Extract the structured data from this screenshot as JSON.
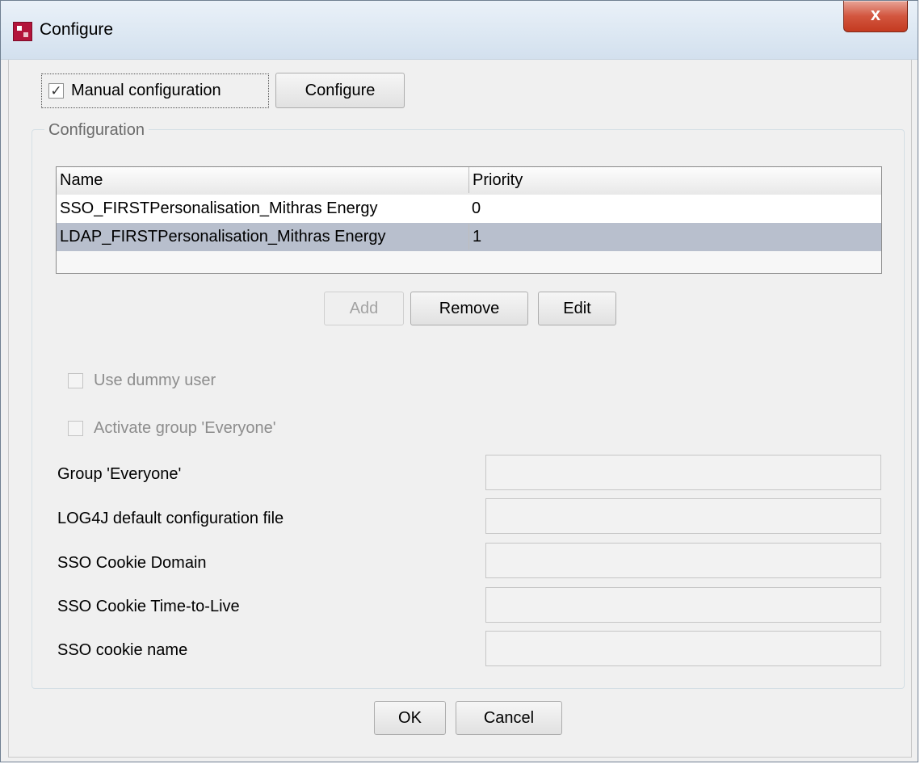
{
  "window": {
    "title": "Configure",
    "close_label": "x"
  },
  "top": {
    "manual_config_label": "Manual configuration",
    "manual_config_checked": true,
    "configure_button": "Configure"
  },
  "group": {
    "legend": "Configuration",
    "table": {
      "columns": [
        "Name",
        "Priority"
      ],
      "rows": [
        {
          "name": "SSO_FIRSTPersonalisation_Mithras Energy",
          "priority": "0",
          "selected": false
        },
        {
          "name": "LDAP_FIRSTPersonalisation_Mithras Energy",
          "priority": "1",
          "selected": true
        }
      ]
    },
    "buttons": {
      "add": "Add",
      "remove": "Remove",
      "edit": "Edit"
    },
    "checkboxes": {
      "dummy_user": "Use dummy user",
      "activate_everyone": "Activate group 'Everyone'"
    },
    "fields": [
      {
        "label": "Group 'Everyone'",
        "value": ""
      },
      {
        "label": "LOG4J default configuration file",
        "value": ""
      },
      {
        "label": "SSO Cookie Domain",
        "value": ""
      },
      {
        "label": "SSO Cookie Time-to-Live",
        "value": ""
      },
      {
        "label": "SSO cookie name",
        "value": ""
      }
    ]
  },
  "footer": {
    "ok": "OK",
    "cancel": "Cancel"
  },
  "colors": {
    "selected_row": "#b8bfcd",
    "close_button": "#c43a20",
    "app_icon": "#b3143b"
  }
}
